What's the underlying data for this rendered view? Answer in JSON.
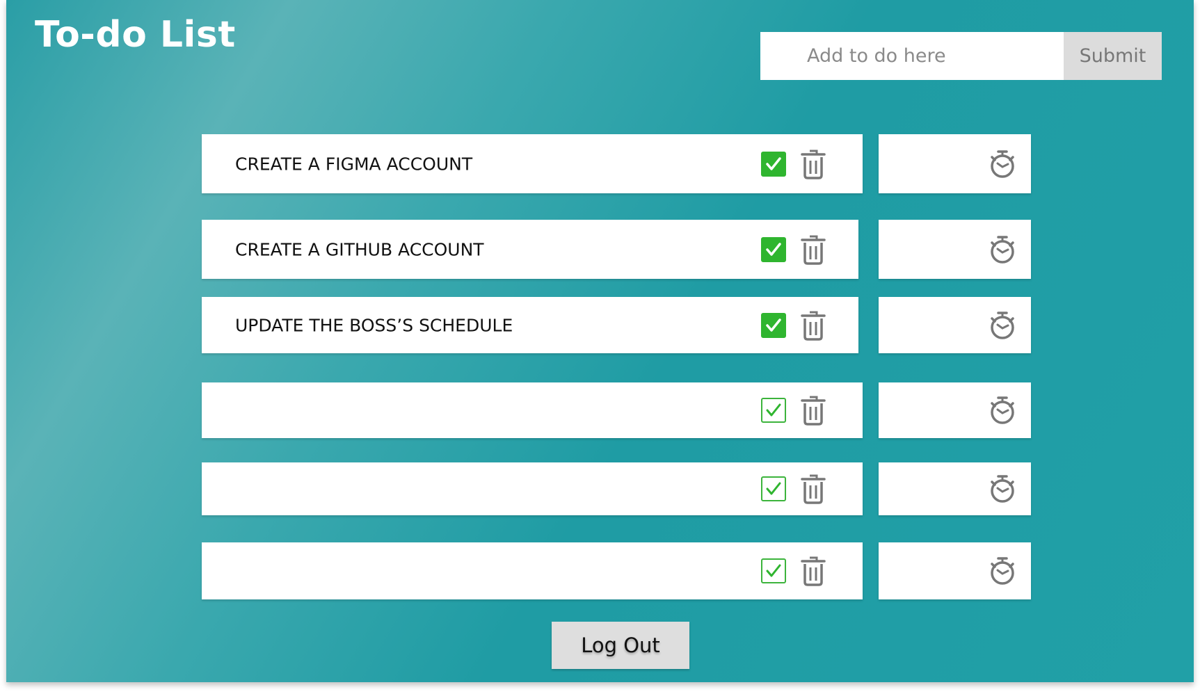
{
  "app": {
    "title": "To-do List"
  },
  "add_form": {
    "placeholder": "Add to do here",
    "value": "",
    "submit_label": "Submit"
  },
  "todos": [
    {
      "text": "CREATE A FIGMA ACCOUNT",
      "checked": true
    },
    {
      "text": "CREATE A GITHUB ACCOUNT",
      "checked": true
    },
    {
      "text": "UPDATE THE BOSS’S SCHEDULE",
      "checked": true
    },
    {
      "text": "",
      "checked": false
    },
    {
      "text": "",
      "checked": false
    },
    {
      "text": "",
      "checked": false
    }
  ],
  "icons": {
    "check": "checkbox-check-icon",
    "delete": "trash-icon",
    "timer": "stopwatch-icon"
  },
  "footer": {
    "logout_label": "Log Out"
  },
  "colors": {
    "background": "#21a0a7",
    "check_green": "#2fb52f",
    "icon_gray": "#777777",
    "button_gray": "#dcdcdc"
  }
}
